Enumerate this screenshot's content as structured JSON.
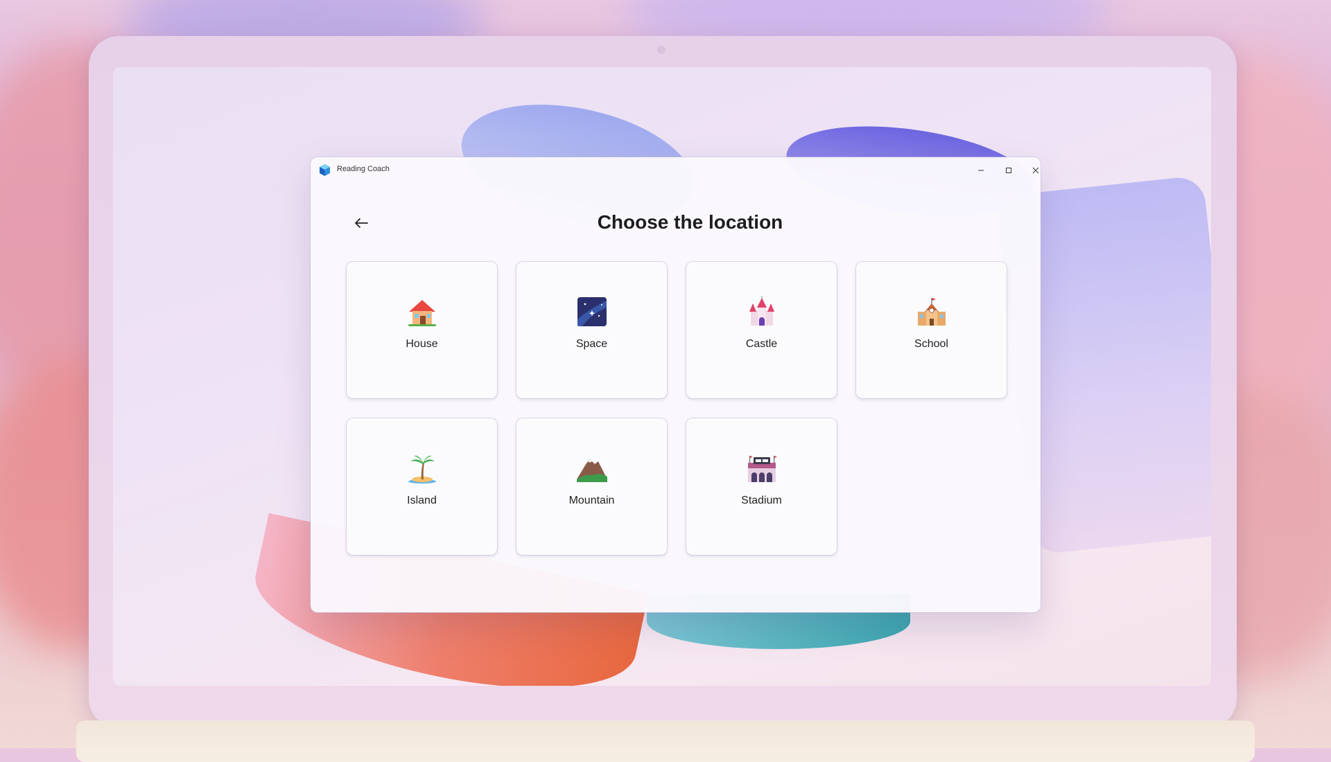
{
  "window": {
    "app_title": "Reading Coach",
    "controls": {
      "minimize": "minimize-icon",
      "maximize": "maximize-icon",
      "close": "close-icon"
    }
  },
  "page": {
    "back_icon": "arrow-left-icon",
    "title": "Choose the location"
  },
  "locations": [
    {
      "label": "House",
      "icon": "house-icon"
    },
    {
      "label": "Space",
      "icon": "space-icon"
    },
    {
      "label": "Castle",
      "icon": "castle-icon"
    },
    {
      "label": "School",
      "icon": "school-icon"
    },
    {
      "label": "Island",
      "icon": "island-icon"
    },
    {
      "label": "Mountain",
      "icon": "mountain-icon"
    },
    {
      "label": "Stadium",
      "icon": "stadium-icon"
    }
  ]
}
